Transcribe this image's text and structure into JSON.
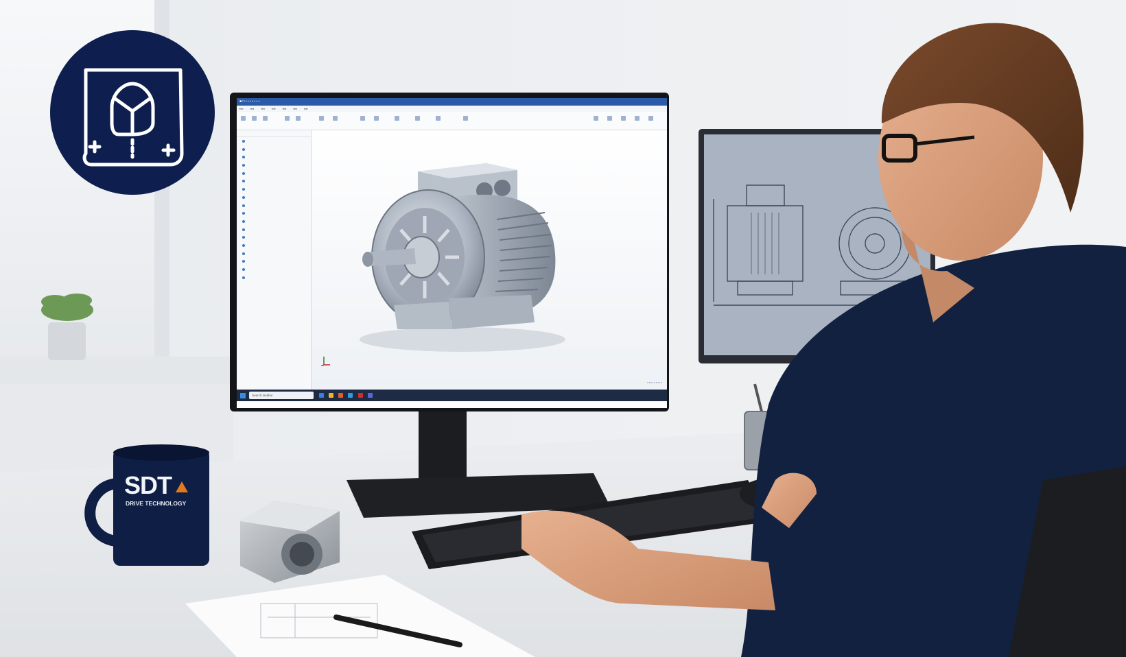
{
  "logo_badge": {
    "icon": "cad-drawing-icon",
    "color": "#0e1f4f"
  },
  "mug": {
    "brand": "SDT",
    "subtitle": "DRIVE TECHNOLOGY",
    "accent_color": "#e07a1c",
    "color": "#0f1e45"
  },
  "main_monitor": {
    "app": "3D CAD",
    "model": "electric motor",
    "tree_items": 18,
    "taskbar_search": "Search taskbar"
  },
  "side_monitor": {
    "content": "2D technical drawing"
  },
  "colors": {
    "shirt": "#12213f",
    "accent": "#2a5aa8"
  }
}
